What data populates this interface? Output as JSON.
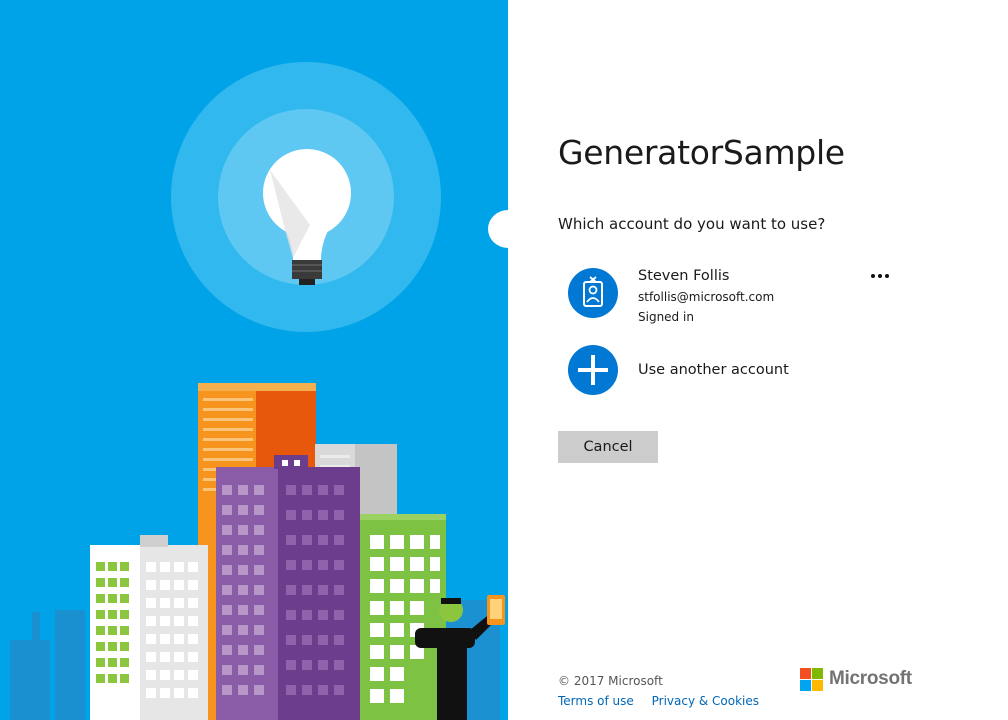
{
  "app": {
    "title": "GeneratorSample",
    "question": "Which account do you want to use?"
  },
  "accounts": [
    {
      "name": "Steven Follis",
      "email": "stfollis@microsoft.com",
      "status": "Signed in",
      "icon": "badge-icon",
      "more_icon": "more-options-icon"
    }
  ],
  "use_another": {
    "label": "Use another account",
    "icon": "plus-icon"
  },
  "buttons": {
    "cancel": "Cancel"
  },
  "footer": {
    "copyright": "© 2017 Microsoft",
    "terms": "Terms of use",
    "privacy": "Privacy & Cookies",
    "logo_text": "Microsoft"
  },
  "colors": {
    "sky": "#00a2e8",
    "accent": "#0078d4",
    "link": "#0067b8",
    "logo_red": "#f25022",
    "logo_green": "#7fba00",
    "logo_blue": "#00a4ef",
    "logo_yellow": "#ffb900"
  }
}
